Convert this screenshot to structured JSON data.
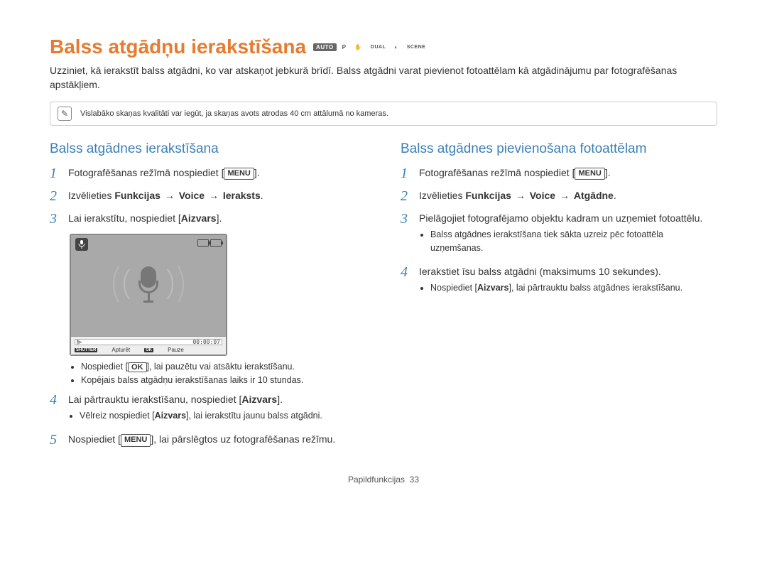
{
  "page_title": "Balss atgādņu ierakstīšana",
  "mode_badges": {
    "auto": "AUTO",
    "p": "P",
    "dual": "DUAL",
    "scene": "SCENE"
  },
  "intro_text": "Uzziniet, kā ierakstīt balss atgādni, ko var atskaņot jebkurā brīdī. Balss atgādni varat pievienot fotoattēlam kā atgādinājumu par fotografēšanas apstākļiem.",
  "note_text": "Vislabāko skaņas kvalitāti var iegūt, ja skaņas avots atrodas 40 cm attālumā no kameras.",
  "left": {
    "heading": "Balss atgādnes ierakstīšana",
    "step1_pre": "Fotografēšanas režīmā nospiediet [",
    "step1_btn": "MENU",
    "step1_post": "].",
    "step2_pre": "Izvēlieties ",
    "step2_b1": "Funkcijas",
    "step2_arrow": "→",
    "step2_b2": "Voice",
    "step2_b3": "Ieraksts",
    "step3_pre": "Lai ierakstītu, nospiediet [",
    "step3_b": "Aizvars",
    "step3_post": "].",
    "screen": {
      "time": "00:00:07",
      "btn1_tag": "SHUTTER",
      "btn1_label": "Apturēt",
      "btn2_tag": "OK",
      "btn2_label": "Pauze"
    },
    "notes_a1_pre": "Nospiediet [",
    "notes_a1_btn": "OK",
    "notes_a1_post": "], lai pauzētu vai atsāktu ierakstīšanu.",
    "notes_a2": "Kopējais balss atgādņu ierakstīšanas laiks ir 10 stundas.",
    "step4_pre": "Lai pārtrauktu ierakstīšanu, nospiediet [",
    "step4_b": "Aizvars",
    "step4_post": "].",
    "notes_b1_pre": "Vēlreiz nospiediet [",
    "notes_b1_b": "Aizvars",
    "notes_b1_post": "], lai ierakstītu jaunu balss atgādni.",
    "step5_pre": "Nospiediet [",
    "step5_btn": "MENU",
    "step5_post": "], lai pārslēgtos uz fotografēšanas režīmu."
  },
  "right": {
    "heading": "Balss atgādnes pievienošana fotoattēlam",
    "step1_pre": "Fotografēšanas režīmā nospiediet [",
    "step1_btn": "MENU",
    "step1_post": "].",
    "step2_pre": "Izvēlieties ",
    "step2_b1": "Funkcijas",
    "step2_arrow": "→",
    "step2_b2": "Voice",
    "step2_b3": "Atgādne",
    "step3": "Pielāgojiet fotografējamo objektu kadram un uzņemiet fotoattēlu.",
    "note3": "Balss atgādnes ierakstīšana tiek sākta uzreiz pēc fotoattēla uzņemšanas.",
    "step4": "Ierakstiet īsu balss atgādni (maksimums 10 sekundes).",
    "note4_pre": "Nospiediet [",
    "note4_b": "Aizvars",
    "note4_post": "], lai pārtrauktu balss atgādnes ierakstīšanu."
  },
  "footer_label": "Papildfunkcijas",
  "footer_page": "33"
}
